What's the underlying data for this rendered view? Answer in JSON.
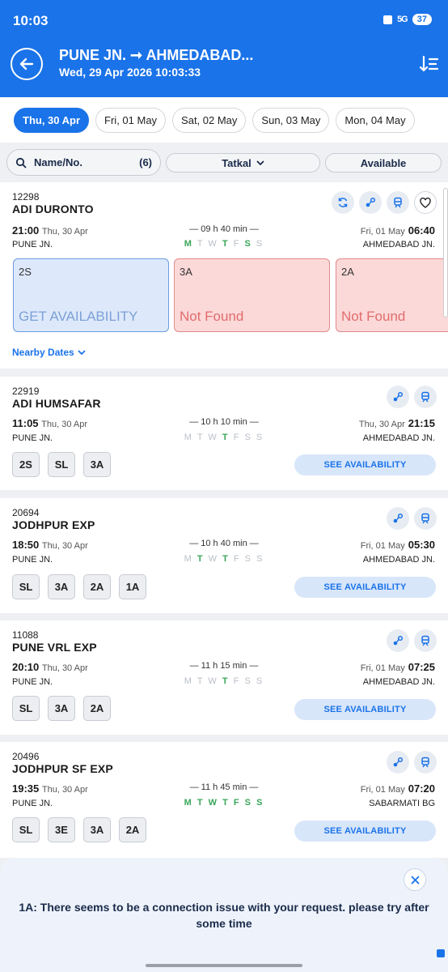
{
  "status_bar": {
    "time": "10:03",
    "signal": "5G",
    "battery": "37"
  },
  "header": {
    "title": "PUNE JN. ➞ AHMEDABAD...",
    "subtitle": "Wed, 29 Apr 2026 10:03:33"
  },
  "dates": [
    "Thu, 30 Apr",
    "Fri, 01 May",
    "Sat, 02 May",
    "Sun, 03 May",
    "Mon, 04 May"
  ],
  "filters": {
    "search_label": "Name/No.",
    "search_count": "(6)",
    "quota": "Tatkal",
    "availability": "Available"
  },
  "trains": [
    {
      "number": "12298",
      "name": "ADI DURONTO",
      "dep_time": "21:00",
      "dep_date": "Thu, 30 Apr",
      "from": "PUNE JN.",
      "arr_time": "06:40",
      "arr_date": "Fri, 01 May",
      "to": "AHMEDABAD JN.",
      "duration": "— 09 h 40 min —",
      "classes": [
        {
          "cls": "2S",
          "status": "GET AVAILABILITY"
        },
        {
          "cls": "3A",
          "status": "Not Found"
        },
        {
          "cls": "2A",
          "status": "Not Found"
        }
      ],
      "nearby": "Nearby Dates"
    },
    {
      "number": "22919",
      "name": "ADI HUMSAFAR",
      "dep_time": "11:05",
      "dep_date": "Thu, 30 Apr",
      "from": "PUNE JN.",
      "arr_time": "21:15",
      "arr_date": "Thu, 30 Apr",
      "to": "AHMEDABAD JN.",
      "duration": "— 10 h 10 min —",
      "chips": [
        "2S",
        "SL",
        "3A"
      ]
    },
    {
      "number": "20694",
      "name": "JODHPUR EXP",
      "dep_time": "18:50",
      "dep_date": "Thu, 30 Apr",
      "from": "PUNE JN.",
      "arr_time": "05:30",
      "arr_date": "Fri, 01 May",
      "to": "AHMEDABAD JN.",
      "duration": "— 10 h 40 min —",
      "chips": [
        "SL",
        "3A",
        "2A",
        "1A"
      ]
    },
    {
      "number": "11088",
      "name": "PUNE VRL EXP",
      "dep_time": "20:10",
      "dep_date": "Thu, 30 Apr",
      "from": "PUNE JN.",
      "arr_time": "07:25",
      "arr_date": "Fri, 01 May",
      "to": "AHMEDABAD JN.",
      "duration": "— 11 h 15 min —",
      "chips": [
        "SL",
        "3A",
        "2A"
      ]
    },
    {
      "number": "20496",
      "name": "JODHPUR SF EXP",
      "dep_time": "19:35",
      "dep_date": "Thu, 30 Apr",
      "from": "PUNE JN.",
      "arr_time": "07:20",
      "arr_date": "Fri, 01 May",
      "to": "SABARMATI BG",
      "duration": "— 11 h 45 min —",
      "chips": [
        "SL",
        "3E",
        "3A",
        "2A"
      ]
    }
  ],
  "see_availability": "SEE AVAILABILITY",
  "toast": {
    "message": "1A: There seems to be a connection issue with your request. please try after some time"
  },
  "colors": {
    "brand": "#1a73e8",
    "run_day": "#3aa65a",
    "error_bg": "#fcd9d9"
  }
}
